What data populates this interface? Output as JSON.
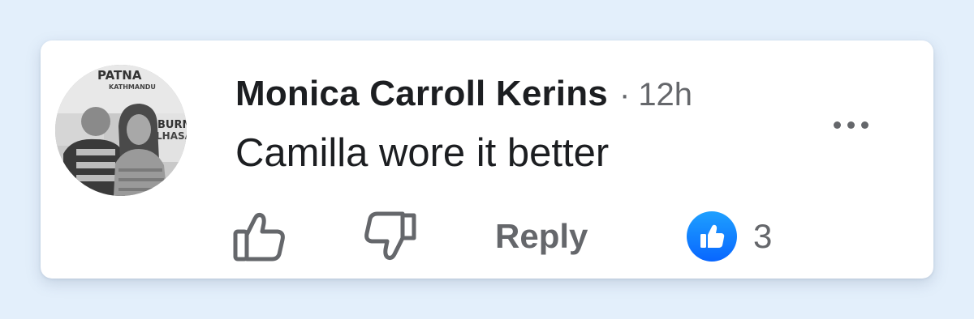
{
  "comment": {
    "author": "Monica Carroll Kerins",
    "separator": "·",
    "timestamp": "12h",
    "text": "Camilla wore it better",
    "avatar_sign_text": [
      "PATNA",
      "KATHMANDU",
      "BURN",
      "LHASA"
    ]
  },
  "actions": {
    "like_icon": "thumbs-up-outline-icon",
    "dislike_icon": "thumbs-down-outline-icon",
    "reply_label": "Reply",
    "reaction_icon": "like-reaction-icon",
    "reaction_count": "3"
  },
  "menu": {
    "icon": "more-options-icon"
  },
  "colors": {
    "background": "#e3effb",
    "card": "#ffffff",
    "text_primary": "#1c1e21",
    "text_secondary": "#65676b",
    "like_blue": "#0866ff"
  }
}
